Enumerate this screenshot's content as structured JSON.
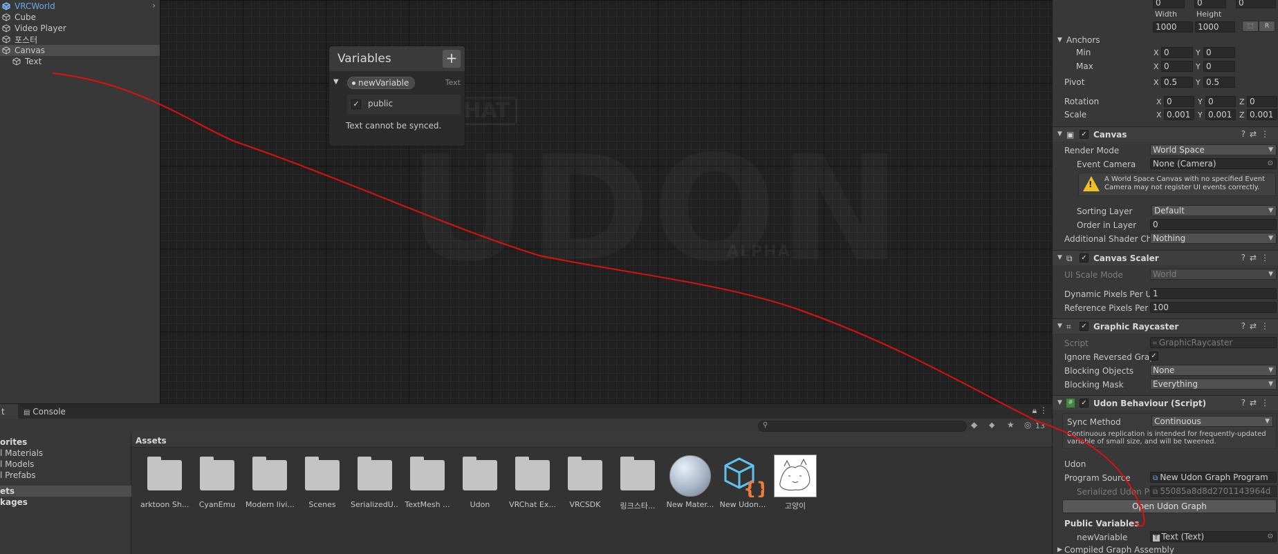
{
  "hierarchy": {
    "items": [
      {
        "label": "VRCWorld"
      },
      {
        "label": "Cube"
      },
      {
        "label": "Video Player"
      },
      {
        "label": "포스터"
      },
      {
        "label": "Canvas"
      },
      {
        "label": "Text"
      }
    ]
  },
  "graph": {
    "variables_panel": {
      "title": "Variables",
      "add_label": "+",
      "variable_name": "newVariable",
      "variable_type": "Text",
      "public_label": "public",
      "public_checked": true,
      "note": "Text cannot be synced."
    }
  },
  "bottom": {
    "tabs": [
      "t",
      "Console"
    ],
    "hidden_count": "13",
    "favorites": [
      "orites",
      "l Materials",
      "l Models",
      "l Prefabs"
    ],
    "roots": [
      "ets",
      "kages"
    ],
    "assets_title": "Assets",
    "assets": [
      {
        "name": "arktoon Sh...",
        "kind": "folder"
      },
      {
        "name": "CyanEmu",
        "kind": "folder"
      },
      {
        "name": "Modern livi...",
        "kind": "folder"
      },
      {
        "name": "Scenes",
        "kind": "folder"
      },
      {
        "name": "SerializedU...",
        "kind": "folder"
      },
      {
        "name": "TextMesh ...",
        "kind": "folder"
      },
      {
        "name": "Udon",
        "kind": "folder"
      },
      {
        "name": "VRChat Ex...",
        "kind": "folder"
      },
      {
        "name": "VRCSDK",
        "kind": "folder"
      },
      {
        "name": "링크스타...",
        "kind": "folder"
      },
      {
        "name": "New Mater...",
        "kind": "material"
      },
      {
        "name": "New Udon...",
        "kind": "udon"
      },
      {
        "name": "고양이",
        "kind": "image"
      }
    ]
  },
  "inspector": {
    "rect": {
      "top_values": [
        "0",
        "0",
        "0"
      ],
      "width_label": "Width",
      "height_label": "Height",
      "width": "1000",
      "height": "1000",
      "blueprint_label": "R"
    },
    "anchors": {
      "label": "Anchors",
      "min_label": "Min",
      "max_label": "Max",
      "min_x": "0",
      "min_y": "0",
      "max_x": "0",
      "max_y": "0"
    },
    "pivot": {
      "label": "Pivot",
      "x": "0.5",
      "y": "0.5"
    },
    "rotation": {
      "label": "Rotation",
      "x": "0",
      "y": "0",
      "z": "0"
    },
    "scale": {
      "label": "Scale",
      "x": "0.001",
      "y": "0.001",
      "z": "0.001"
    },
    "axis_labels": {
      "x": "X",
      "y": "Y",
      "z": "Z"
    },
    "canvas": {
      "title": "Canvas",
      "render_mode_label": "Render Mode",
      "render_mode": "World Space",
      "event_camera_label": "Event Camera",
      "event_camera": "None (Camera)",
      "warning": "A World Space Canvas with no specified Event Camera may not register UI events correctly.",
      "sorting_layer_label": "Sorting Layer",
      "sorting_layer": "Default",
      "order_label": "Order in Layer",
      "order": "0",
      "shader_label": "Additional Shader Ch",
      "shader": "Nothing"
    },
    "canvas_scaler": {
      "title": "Canvas Scaler",
      "scale_mode_label": "UI Scale Mode",
      "scale_mode": "World",
      "dynamic_label": "Dynamic Pixels Per U",
      "dynamic": "1",
      "reference_label": "Reference Pixels Per",
      "reference": "100"
    },
    "raycaster": {
      "title": "Graphic Raycaster",
      "script_label": "Script",
      "script": "GraphicRaycaster",
      "ignore_label": "Ignore Reversed Grap",
      "ignore_checked": true,
      "blocking_objects_label": "Blocking Objects",
      "blocking_objects": "None",
      "blocking_mask_label": "Blocking Mask",
      "blocking_mask": "Everything"
    },
    "udon": {
      "title": "Udon Behaviour (Script)",
      "sync_label": "Sync Method",
      "sync": "Continuous",
      "sync_help": "Continuous replication is intended for frequently-updated variable of small size, and will be tweened.",
      "section_label": "Udon",
      "program_label": "Program Source",
      "program": "New Udon Graph Program",
      "serialized_label": "Serialized Udon Pr",
      "serialized": "55085a8d8d2701143964d",
      "open_button": "Open Udon Graph",
      "public_vars_label": "Public Variables",
      "var_name": "newVariable",
      "var_value": "Text (Text)",
      "compiled_label": "Compiled Graph Assembly"
    }
  },
  "colors": {
    "accent_link": "#6aa7e6",
    "annotation": "#e01010",
    "warning": "#f0c020",
    "udon_blue": "#5fc3f0",
    "udon_orange": "#f07a3a"
  }
}
